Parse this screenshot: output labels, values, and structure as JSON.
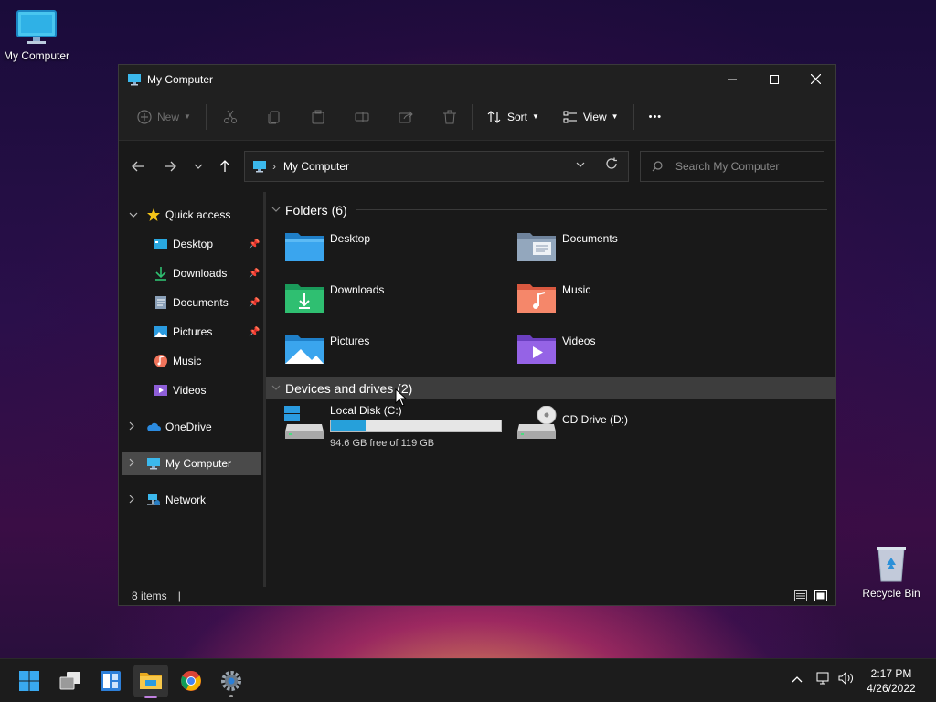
{
  "desktop": {
    "my_computer_label": "My Computer",
    "recycle_bin_label": "Recycle Bin"
  },
  "window": {
    "title": "My Computer",
    "controls": {
      "minimize": "—",
      "maximize": "☐",
      "close": "✕"
    }
  },
  "commandbar": {
    "new_label": "New",
    "sort_label": "Sort",
    "view_label": "View",
    "more_label": "•••",
    "icons": [
      "plus-circle-icon",
      "cut-icon",
      "copy-icon",
      "paste-icon",
      "rename-icon",
      "share-icon",
      "delete-icon"
    ]
  },
  "navigation": {
    "address_text": "My Computer",
    "search_placeholder": "Search My Computer"
  },
  "sidebar": {
    "items": [
      {
        "label": "Quick access",
        "icon": "star-icon"
      },
      {
        "label": "Desktop",
        "icon": "desktop-icon",
        "pinned": true
      },
      {
        "label": "Downloads",
        "icon": "download-icon",
        "pinned": true
      },
      {
        "label": "Documents",
        "icon": "document-icon",
        "pinned": true
      },
      {
        "label": "Pictures",
        "icon": "pictures-icon",
        "pinned": true
      },
      {
        "label": "Music",
        "icon": "music-icon"
      },
      {
        "label": "Videos",
        "icon": "videos-icon"
      },
      {
        "label": "OneDrive",
        "icon": "cloud-icon"
      },
      {
        "label": "My Computer",
        "icon": "computer-icon",
        "selected": true
      },
      {
        "label": "Network",
        "icon": "network-icon"
      }
    ]
  },
  "content": {
    "folders_header": "Folders (6)",
    "folders": [
      {
        "label": "Desktop",
        "icon": "desktop-folder-icon"
      },
      {
        "label": "Documents",
        "icon": "documents-folder-icon"
      },
      {
        "label": "Downloads",
        "icon": "downloads-folder-icon"
      },
      {
        "label": "Music",
        "icon": "music-folder-icon"
      },
      {
        "label": "Pictures",
        "icon": "pictures-folder-icon"
      },
      {
        "label": "Videos",
        "icon": "videos-folder-icon"
      }
    ],
    "drives_header": "Devices and drives (2)",
    "drives": [
      {
        "label": "Local Disk (C:)",
        "free_text": "94.6 GB free of 119 GB",
        "used_fraction": 0.205
      },
      {
        "label": "CD Drive (D:)"
      }
    ]
  },
  "statusbar": {
    "items_text": "8 items",
    "caret": "|"
  },
  "taskbar": {
    "apps": [
      "windows-start-icon",
      "task-view-icon",
      "widgets-icon",
      "file-explorer-icon",
      "chrome-icon",
      "settings-icon"
    ],
    "time": "2:17 PM",
    "date": "4/26/2022"
  },
  "colors": {
    "accent": "#26a0da",
    "window_bg": "#191919",
    "titlebar_bg": "#202020",
    "selection_bg": "#4a4a4a"
  }
}
